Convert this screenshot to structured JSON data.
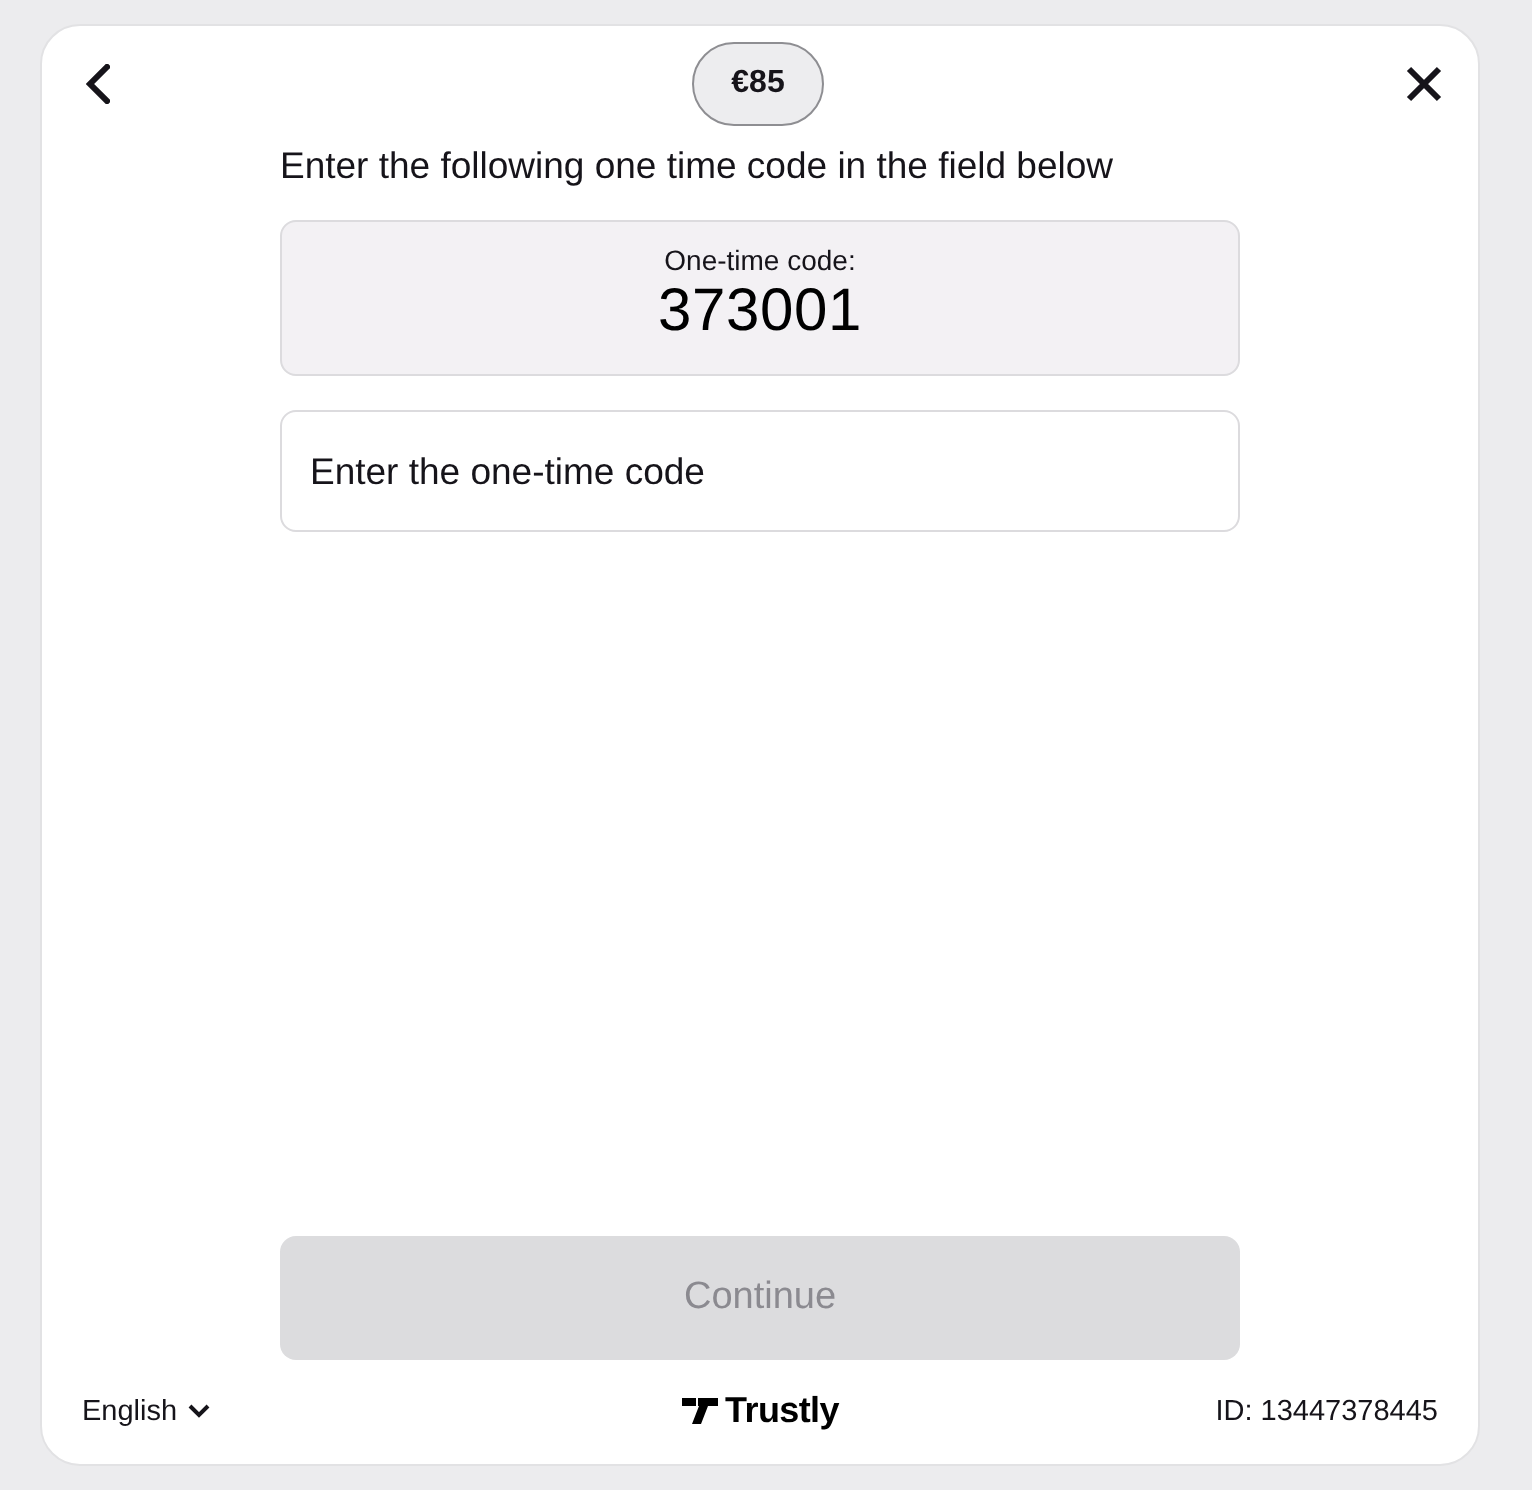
{
  "amount": "€85",
  "instruction": "Enter the following one time code in the field below",
  "code_box": {
    "label": "One-time code:",
    "code": "373001"
  },
  "code_field": {
    "placeholder": "Enter the one-time code"
  },
  "continue_button": {
    "label": "Continue",
    "disabled": true
  },
  "footer": {
    "language": "English",
    "brand": "Trustly",
    "id": "ID: 13447378445"
  }
}
